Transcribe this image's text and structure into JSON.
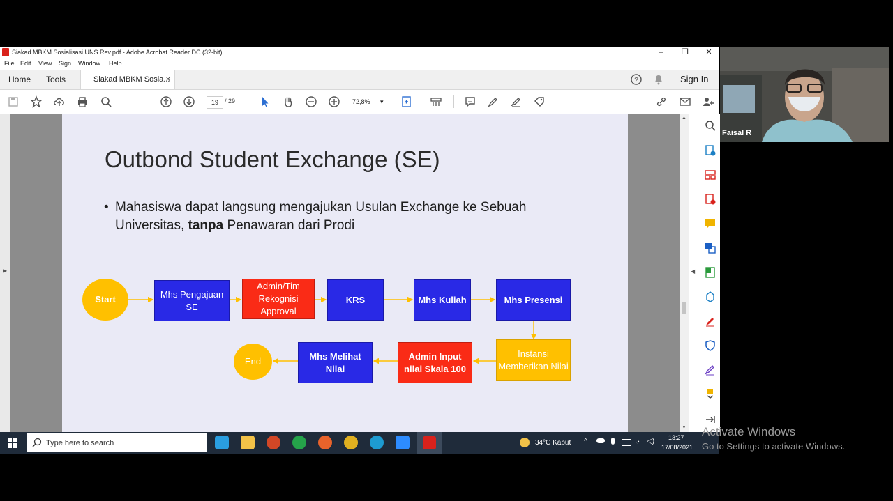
{
  "window": {
    "title": "Siakad MBKM Sosialisasi UNS Rev.pdf - Adobe Acrobat Reader DC (32-bit)",
    "controls": {
      "minimize": "–",
      "restore": "❐",
      "close": "✕"
    }
  },
  "menu": [
    "File",
    "Edit",
    "View",
    "Sign",
    "Window",
    "Help"
  ],
  "tabs": {
    "home": "Home",
    "tools": "Tools",
    "doc": "Siakad MBKM Sosia...",
    "close": "×",
    "sign_in": "Sign In"
  },
  "toolbar": {
    "page_current": "19",
    "page_total": "/ 29",
    "zoom": "72,8%"
  },
  "slide": {
    "title": "Outbond Student Exchange (SE)",
    "bullet_part1": "Mahasiswa dapat langsung mengajukan Usulan Exchange ke Sebuah Universitas, ",
    "bullet_bold": "tanpa",
    "bullet_part2": " Penawaran dari Prodi",
    "nodes": {
      "start": "Start",
      "pengajuan": "Mhs Pengajuan SE",
      "admin_tim": "Admin/Tim Rekognisi Approval",
      "krs": "KRS",
      "kuliah": "Mhs Kuliah",
      "presensi": "Mhs  Presensi",
      "instansi": "Instansi Memberikan Nilai",
      "admin_input": "Admin Input nilai Skala 100",
      "melihat": "Mhs Melihat Nilai",
      "end": "End"
    },
    "colors": {
      "blue": "#2929e6",
      "red": "#fa2b16",
      "orange": "#ffc000",
      "arrow": "#ffc000"
    }
  },
  "taskbar": {
    "search_placeholder": "Type here to search",
    "weather": "34°C  Kabut",
    "time": "13:27",
    "date": "17/08/2021"
  },
  "webcam": {
    "name": "Faisal R"
  },
  "watermark": {
    "line1": "Activate Windows",
    "line2": "Go to Settings to activate Windows."
  }
}
